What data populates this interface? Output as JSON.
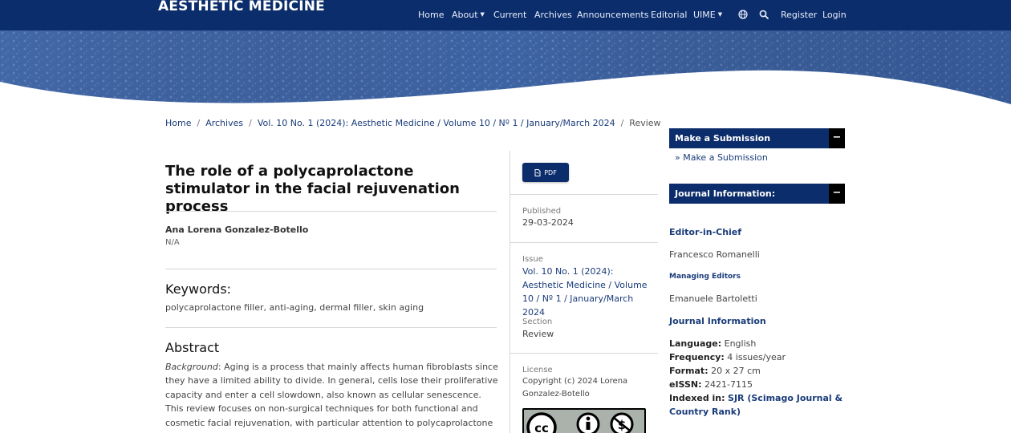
{
  "header": {
    "brand": "AESTHETIC MEDICINE",
    "nav": {
      "home": "Home",
      "about": "About",
      "current": "Current",
      "archives": "Archives",
      "announcements": "Announcements",
      "editorial": "Editorial",
      "uime": "UIME",
      "register": "Register",
      "login": "Login"
    },
    "icons": [
      "globe-icon",
      "search-icon"
    ]
  },
  "breadcrumb": {
    "home": "Home",
    "archives": "Archives",
    "issue": "Vol. 10 No. 1 (2024): Aesthetic Medicine / Volume 10 / Nº 1 / January/March 2024",
    "current": "Review"
  },
  "article": {
    "title": "The role of a polycaprolactone stimulator in the facial rejuvenation process",
    "author_name": "Ana Lorena Gonzalez-Botello",
    "author_affiliation": "N/A",
    "keywords_heading": "Keywords:",
    "keywords": "polycaprolactone filler, anti-aging, dermal filler, skin aging",
    "abstract_heading": "Abstract",
    "abstract_label": "Background",
    "abstract_body": ": Aging is a process that mainly affects human fibroblasts since they have a limited ability to divide. In general, cells lose their proliferative capacity and enter a cell slowdown, also known as cellular senescence. This review focuses on non-surgical techniques for both functional and cosmetic facial rejuvenation, with particular attention to polycaprolactone (PCL) fillers as an effective collagen"
  },
  "details": {
    "pdf_label": "PDF",
    "published_label": "Published",
    "published_value": "29-03-2024",
    "issue_label": "Issue",
    "issue_value": "Vol. 10 No. 1 (2024): Aesthetic Medicine / Volume 10 / Nº 1 / January/March 2024",
    "section_label": "Section",
    "section_value": "Review",
    "license_label": "License",
    "license_text": "Copyright (c) 2024 Lorena Gonzalez-Botello",
    "license_badge": "cc-by-nc-icon"
  },
  "sidebar": {
    "submission_heading": "Make a Submission",
    "submission_link": "» Make a Submission",
    "journal_heading": "Journal Information:",
    "toggle_symbol": "−",
    "editor_heading": "Editor-in-Chief",
    "editor_name": "Francesco Romanelli",
    "managing_heading": "Managing Editors",
    "managing_name": "Emanuele Bartoletti",
    "journal_info_heading": "Journal Information",
    "language_label": "Language:",
    "language_value": "English",
    "frequency_label": "Frequency:",
    "frequency_value": "4 issues/year",
    "format_label": "Format:",
    "format_value": "20 x 27 cm",
    "eissn_label": "eISSN:",
    "eissn_value": "2421-7115",
    "indexed_label": "Indexed in:",
    "indexed_line1": "SJR (Scimago Journal &",
    "indexed_line2": "Country Rank)"
  },
  "colors": {
    "navy": "#0c2d6b",
    "link": "#1a3c7a",
    "banner": "#3d62a0"
  }
}
